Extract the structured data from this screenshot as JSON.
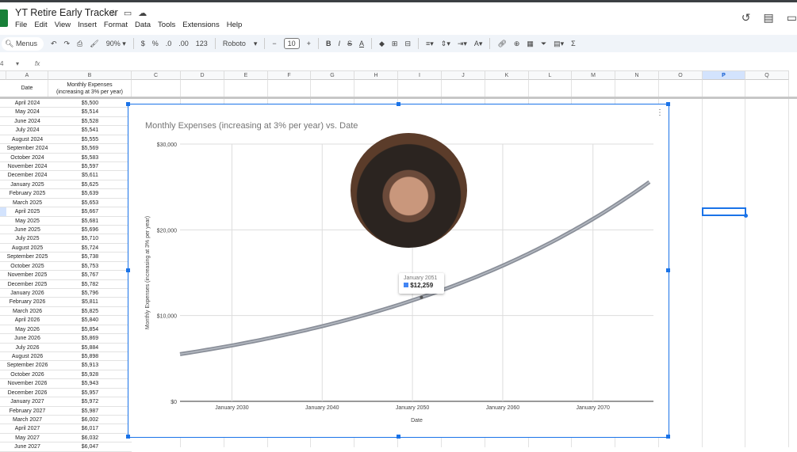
{
  "app": {
    "title": "YT Retire Early Tracker",
    "menu": [
      "File",
      "Edit",
      "View",
      "Insert",
      "Format",
      "Data",
      "Tools",
      "Extensions",
      "Help"
    ]
  },
  "toolbar": {
    "search": "Menus",
    "zoom": "90%",
    "currency": "$",
    "percent": "%",
    "dec_less": ".0",
    "dec_more": ".00",
    "number_format": "123",
    "font": "Roboto",
    "font_size": "10",
    "bold": "B",
    "italic": "I",
    "sum": "Σ"
  },
  "formula_bar": {
    "cell_ref": "4",
    "fx": "fx"
  },
  "columns": [
    "A",
    "B",
    "C",
    "D",
    "E",
    "F",
    "G",
    "H",
    "I",
    "J",
    "K",
    "L",
    "M",
    "N",
    "O",
    "P",
    "Q"
  ],
  "header": {
    "date": "Date",
    "expenses": "Monthly Expenses\n(increasing at 3% per year)"
  },
  "rows": [
    [
      "April 2024",
      "$5,500"
    ],
    [
      "May 2024",
      "$5,514"
    ],
    [
      "June 2024",
      "$5,528"
    ],
    [
      "July 2024",
      "$5,541"
    ],
    [
      "August 2024",
      "$5,555"
    ],
    [
      "September 2024",
      "$5,569"
    ],
    [
      "October 2024",
      "$5,583"
    ],
    [
      "November 2024",
      "$5,597"
    ],
    [
      "December 2024",
      "$5,611"
    ],
    [
      "January 2025",
      "$5,625"
    ],
    [
      "February 2025",
      "$5,639"
    ],
    [
      "March 2025",
      "$5,653"
    ],
    [
      "April 2025",
      "$5,667"
    ],
    [
      "May 2025",
      "$5,681"
    ],
    [
      "June 2025",
      "$5,696"
    ],
    [
      "July 2025",
      "$5,710"
    ],
    [
      "August 2025",
      "$5,724"
    ],
    [
      "September 2025",
      "$5,738"
    ],
    [
      "October 2025",
      "$5,753"
    ],
    [
      "November 2025",
      "$5,767"
    ],
    [
      "December 2025",
      "$5,782"
    ],
    [
      "January 2026",
      "$5,796"
    ],
    [
      "February 2026",
      "$5,811"
    ],
    [
      "March 2026",
      "$5,825"
    ],
    [
      "April 2026",
      "$5,840"
    ],
    [
      "May 2026",
      "$5,854"
    ],
    [
      "June 2026",
      "$5,869"
    ],
    [
      "July 2026",
      "$5,884"
    ],
    [
      "August 2026",
      "$5,898"
    ],
    [
      "September 2026",
      "$5,913"
    ],
    [
      "October 2026",
      "$5,928"
    ],
    [
      "November 2026",
      "$5,943"
    ],
    [
      "December 2026",
      "$5,957"
    ],
    [
      "January 2027",
      "$5,972"
    ],
    [
      "February 2027",
      "$5,987"
    ],
    [
      "March 2027",
      "$6,002"
    ],
    [
      "April 2027",
      "$6,017"
    ],
    [
      "May 2027",
      "$6,032"
    ],
    [
      "June 2027",
      "$6,047"
    ]
  ],
  "chart_data": {
    "type": "line",
    "title": "Monthly Expenses            (increasing at 3% per year) vs. Date",
    "xlabel": "Date",
    "ylabel": "Monthly Expenses            (increasing at 3% per year)",
    "xlim": [
      2024.25,
      2076.7
    ],
    "ylim": [
      0,
      30000
    ],
    "x_ticks": [
      {
        "v": 2030,
        "label": "January 2030"
      },
      {
        "v": 2040,
        "label": "January 2040"
      },
      {
        "v": 2050,
        "label": "January 2050"
      },
      {
        "v": 2060,
        "label": "January 2060"
      },
      {
        "v": 2070,
        "label": "January 2070"
      }
    ],
    "y_ticks": [
      {
        "v": 0,
        "label": "$0"
      },
      {
        "v": 10000,
        "label": "$10,000"
      },
      {
        "v": 20000,
        "label": "$20,000"
      },
      {
        "v": 30000,
        "label": "$30,000"
      }
    ],
    "series": [
      {
        "name": "Monthly Expenses",
        "start_value": 5500,
        "start_x": 2024.25,
        "annual_growth": 0.03,
        "color": "#8a8f99"
      }
    ],
    "tooltip": {
      "x": 2051,
      "label": "January 2051",
      "value": "$12,259",
      "color": "#4285f4"
    }
  }
}
